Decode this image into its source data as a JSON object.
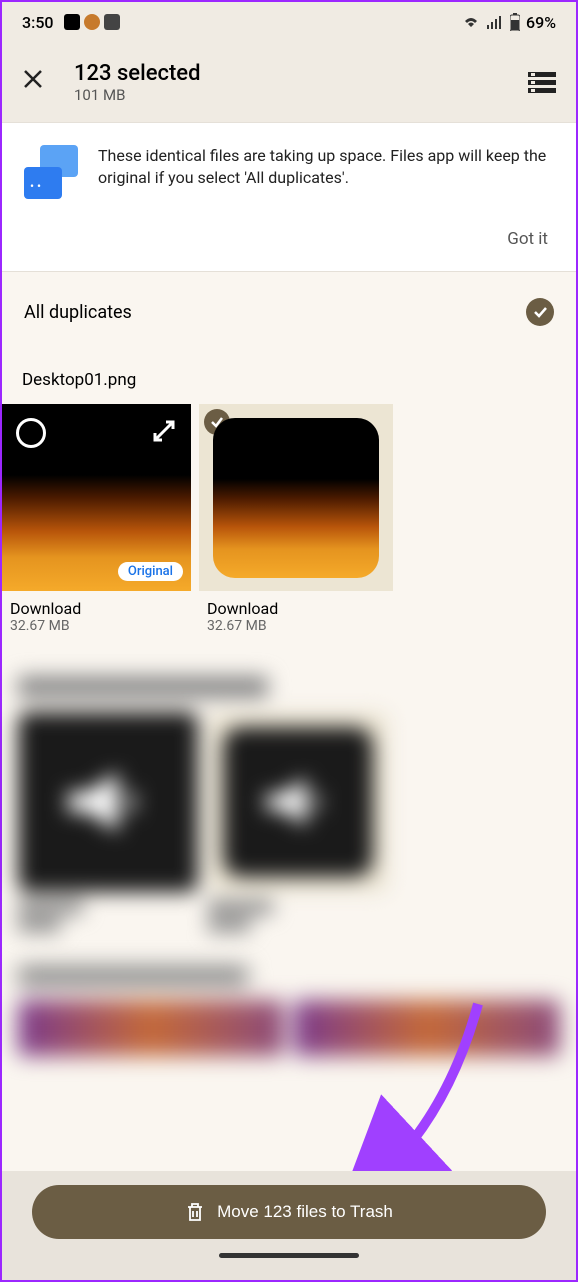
{
  "status": {
    "time": "3:50",
    "battery": "69%"
  },
  "header": {
    "title": "123 selected",
    "subtitle": "101 MB"
  },
  "banner": {
    "text": "These identical files are taking up space. Files app will keep the original if you select 'All duplicates'.",
    "dismiss": "Got it"
  },
  "section": {
    "title": "All duplicates"
  },
  "group1": {
    "filename": "Desktop01.png",
    "original_badge": "Original",
    "items": [
      {
        "location": "Download",
        "size": "32.67 MB"
      },
      {
        "location": "Download",
        "size": "32.67 MB"
      }
    ]
  },
  "action": {
    "button": "Move 123 files to Trash"
  }
}
